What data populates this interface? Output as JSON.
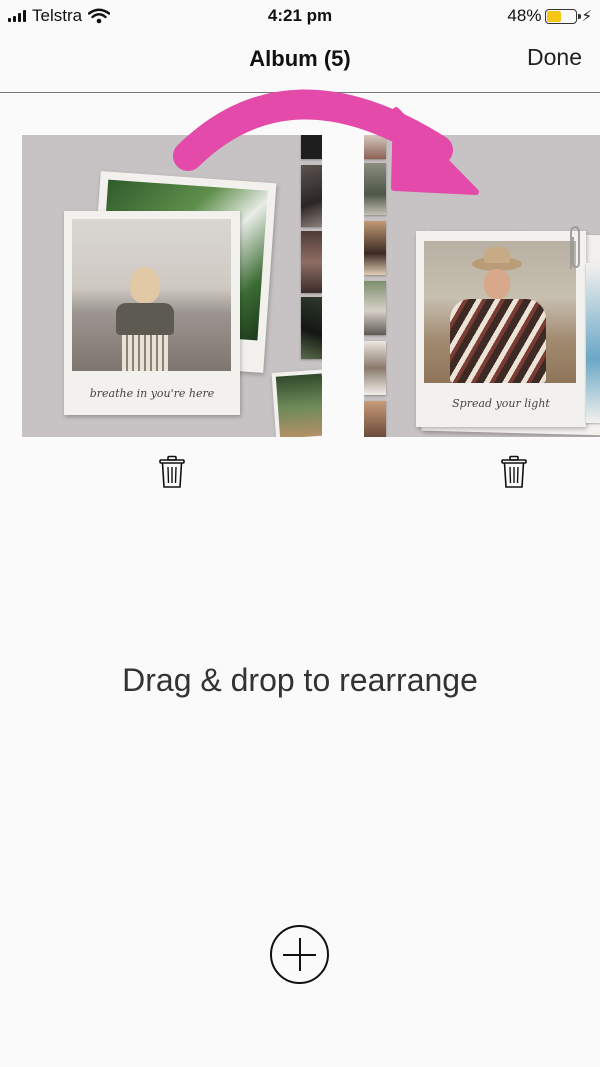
{
  "status_bar": {
    "carrier": "Telstra",
    "time": "4:21 pm",
    "battery_percent": "48%",
    "battery_level": 0.48,
    "signal_icon": "cellular-signal-icon",
    "wifi_icon": "wifi-icon",
    "charging_icon": "charging-bolt-icon"
  },
  "nav": {
    "title": "Album (5)",
    "done_label": "Done"
  },
  "pages": [
    {
      "caption": "breathe in you're here",
      "delete_icon": "trash-icon"
    },
    {
      "caption": "Spread your light",
      "delete_icon": "trash-icon"
    }
  ],
  "hint": "Drag & drop to rearrange",
  "add_icon": "add-page-icon",
  "colors": {
    "accent_arrow": "#e34aa9",
    "page_background": "#c7c2c3",
    "battery_fill": "#f7c614"
  }
}
